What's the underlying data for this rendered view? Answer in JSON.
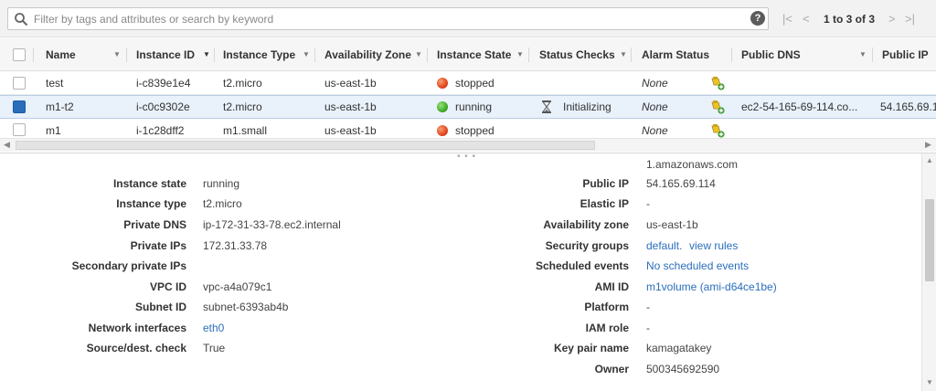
{
  "search": {
    "placeholder": "Filter by tags and attributes or search by keyword",
    "help": "?"
  },
  "pager": {
    "first": "|<",
    "prev": "<",
    "text": "1 to 3 of 3",
    "next": ">",
    "last": ">|"
  },
  "columns": [
    "Name",
    "Instance ID",
    "Instance Type",
    "Availability Zone",
    "Instance State",
    "Status Checks",
    "Alarm Status",
    "Public DNS",
    "Public IP"
  ],
  "rows": [
    {
      "name": "test",
      "id": "i-c839e1e4",
      "type": "t2.micro",
      "az": "us-east-1b",
      "state": "stopped",
      "state_color": "red",
      "status": "",
      "alarm": "None",
      "dns": "",
      "ip": "",
      "selected": false
    },
    {
      "name": "m1-t2",
      "id": "i-c0c9302e",
      "type": "t2.micro",
      "az": "us-east-1b",
      "state": "running",
      "state_color": "green",
      "status": "Initializing",
      "alarm": "None",
      "dns": "ec2-54-165-69-114.co...",
      "ip": "54.165.69.1",
      "selected": true
    },
    {
      "name": "m1",
      "id": "i-1c28dff2",
      "type": "m1.small",
      "az": "us-east-1b",
      "state": "stopped",
      "state_color": "red",
      "status": "",
      "alarm": "None",
      "dns": "",
      "ip": "",
      "selected": false
    }
  ],
  "details": {
    "top_overflow": "1.amazonaws.com",
    "left": [
      {
        "label": "Instance state",
        "value": "running"
      },
      {
        "label": "Instance type",
        "value": "t2.micro"
      },
      {
        "label": "Private DNS",
        "value": "ip-172-31-33-78.ec2.internal"
      },
      {
        "label": "Private IPs",
        "value": "172.31.33.78"
      },
      {
        "label": "Secondary private IPs",
        "value": ""
      },
      {
        "label": "VPC ID",
        "value": "vpc-a4a079c1"
      },
      {
        "label": "Subnet ID",
        "value": "subnet-6393ab4b"
      },
      {
        "label": "Network interfaces",
        "value": "eth0"
      },
      {
        "label": "Source/dest. check",
        "value": "True"
      }
    ],
    "right": [
      {
        "label": "Public IP",
        "value": "54.165.69.114"
      },
      {
        "label": "Elastic IP",
        "value": "-"
      },
      {
        "label": "Availability zone",
        "value": "us-east-1b"
      },
      {
        "label": "Security groups",
        "value": "default.",
        "value2": "view rules"
      },
      {
        "label": "Scheduled events",
        "value": "No scheduled events"
      },
      {
        "label": "AMI ID",
        "value": "m1volume (ami-d64ce1be)"
      },
      {
        "label": "Platform",
        "value": "-"
      },
      {
        "label": "IAM role",
        "value": "-"
      },
      {
        "label": "Key pair name",
        "value": "kamagatakey"
      },
      {
        "label": "Owner",
        "value": "500345692590"
      }
    ]
  },
  "colors": {
    "accent": "#2a6ebb",
    "selected_row": "#e9f1fb",
    "stopped": "#e2451f",
    "running": "#3fae29"
  }
}
